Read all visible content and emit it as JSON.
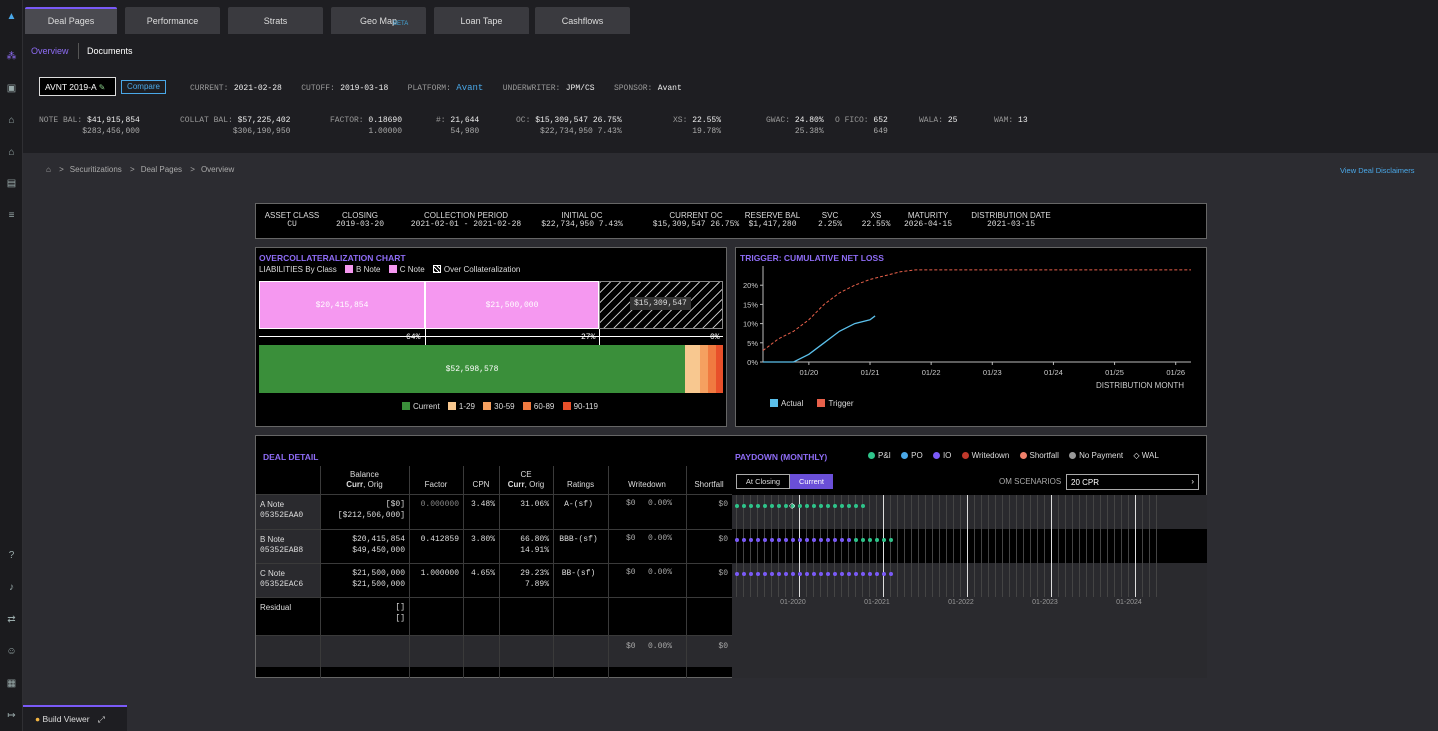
{
  "tabs": [
    "Deal Pages",
    "Performance",
    "Strats",
    "Geo Map",
    "Loan Tape",
    "Cashflows"
  ],
  "beta": "BETA",
  "subtabs": [
    "Overview",
    "Documents"
  ],
  "deal": {
    "name": "AVNT 2019-A",
    "compare": "Compare",
    "current_label": "CURRENT:",
    "current": "2021-02-28",
    "cutoff_label": "CUTOFF:",
    "cutoff": "2019-03-18",
    "platform_label": "PLATFORM:",
    "platform": "Avant",
    "underwriter_label": "UNDERWRITER:",
    "underwriter": "JPM/CS",
    "sponsor_label": "SPONSOR:",
    "sponsor": "Avant"
  },
  "metrics": [
    {
      "label": "NOTE BAL:",
      "v1": "$41,915,854",
      "v2": "$283,456,000"
    },
    {
      "label": "COLLAT BAL:",
      "v1": "$57,225,402",
      "v2": "$306,190,950"
    },
    {
      "label": "FACTOR:",
      "v1": "0.18690",
      "v2": "1.00000"
    },
    {
      "label": "#:",
      "v1": "21,644",
      "v2": "54,980"
    },
    {
      "label": "OC:",
      "v1": "$15,309,547 26.75%",
      "v2": "$22,734,950  7.43%"
    },
    {
      "label": "XS:",
      "v1": "22.55%",
      "v2": "19.78%"
    },
    {
      "label": "GWAC:",
      "v1": "24.80%",
      "v2": "25.38%"
    },
    {
      "label": "O FICO:",
      "v1": "652",
      "v2": "649"
    },
    {
      "label": "WALA:",
      "v1": "25",
      "v2": ""
    },
    {
      "label": "WAM:",
      "v1": "13",
      "v2": ""
    }
  ],
  "breadcrumb": [
    "Securitizations",
    "Deal Pages",
    "Overview"
  ],
  "disclaimers": "View Deal Disclaimers",
  "summary": [
    {
      "h": "ASSET CLASS",
      "v": "CU"
    },
    {
      "h": "CLOSING",
      "v": "2019-03-20"
    },
    {
      "h": "COLLECTION PERIOD",
      "v": "2021-02-01 - 2021-02-28"
    },
    {
      "h": "INITIAL OC",
      "v": "$22,734,950  7.43%"
    },
    {
      "h": "CURRENT OC",
      "v": "$15,309,547  26.75%"
    },
    {
      "h": "RESERVE BAL",
      "v": "$1,417,280"
    },
    {
      "h": "SVC",
      "v": "2.25%"
    },
    {
      "h": "XS",
      "v": "22.55%"
    },
    {
      "h": "MATURITY",
      "v": "2026-04-15"
    },
    {
      "h": "DISTRIBUTION DATE",
      "v": "2021-03-15"
    }
  ],
  "oc_chart": {
    "title": "OVERCOLLATERALIZATION CHART",
    "liab_label": "LIABILITIES By Class",
    "legend": [
      "B Note",
      "C Note",
      "Over Collateralization"
    ],
    "bars": [
      "$20,415,854",
      "$21,500,000",
      "$15,309,547"
    ],
    "pcts": [
      "64%",
      "27%",
      "0%"
    ],
    "collat": "$52,598,578",
    "collat_legend": [
      "Current",
      "1-29",
      "30-59",
      "60-89",
      "90-119"
    ],
    "colors": {
      "b": "#f598f0",
      "c": "#f598f0",
      "current": "#3a8f3a",
      "d1": "#f8c890",
      "d2": "#f5a060",
      "d3": "#f07a40",
      "d4": "#e8502a"
    }
  },
  "trigger_chart": {
    "title": "TRIGGER: CUMULATIVE NET LOSS",
    "yticks": [
      "20%",
      "15%",
      "10%",
      "5%",
      "0%"
    ],
    "xticks": [
      "01/20",
      "01/21",
      "01/22",
      "01/23",
      "01/24",
      "01/25",
      "01/26"
    ],
    "xlabel": "DISTRIBUTION MONTH",
    "legend": [
      "Actual",
      "Trigger"
    ]
  },
  "chart_data": {
    "type": "line",
    "title": "TRIGGER: CUMULATIVE NET LOSS",
    "xlabel": "DISTRIBUTION MONTH",
    "ylabel": "",
    "ylim": [
      0,
      25
    ],
    "series": [
      {
        "name": "Actual",
        "x": [
          "2019-04",
          "2019-07",
          "2019-10",
          "2020-01",
          "2020-04",
          "2020-07",
          "2020-10",
          "2021-01",
          "2021-02"
        ],
        "values": [
          0,
          0,
          0,
          2,
          5,
          8,
          10,
          11,
          12
        ]
      },
      {
        "name": "Trigger",
        "x": [
          "2019-04",
          "2019-07",
          "2019-10",
          "2020-01",
          "2020-04",
          "2020-07",
          "2020-10",
          "2021-01",
          "2021-04",
          "2021-07",
          "2021-10",
          "2022-04",
          "2023-01",
          "2024-01",
          "2025-01",
          "2026-01",
          "2026-04"
        ],
        "values": [
          3,
          6,
          8,
          11,
          15,
          18,
          20,
          21.5,
          22.5,
          23.5,
          24,
          24,
          24,
          24,
          24,
          24,
          24
        ]
      }
    ]
  },
  "deal_detail": {
    "title": "DEAL DETAIL",
    "headers": {
      "balance": "Balance",
      "curr_orig": "Curr",
      "orig": ", Orig",
      "factor": "Factor",
      "cpn": "CPN",
      "ce": "CE",
      "ratings": "Ratings",
      "writedown": "Writedown",
      "shortfall": "Shortfall"
    },
    "rows": [
      {
        "name": "A Note",
        "cusip": "05352EAA0",
        "bal1": "[$0]",
        "bal2": "[$212,506,000]",
        "factor": "0.000000",
        "cpn": "3.48%",
        "ce1": "31.06%",
        "ce2": "",
        "rating": "A-(sf)",
        "wd1": "$0",
        "wd2": "0.00%",
        "sf": "$0"
      },
      {
        "name": "B Note",
        "cusip": "05352EAB8",
        "bal1": "$20,415,854",
        "bal2": "$49,450,000",
        "factor": "0.412859",
        "cpn": "3.80%",
        "ce1": "66.80%",
        "ce2": "14.91%",
        "rating": "BBB-(sf)",
        "wd1": "$0",
        "wd2": "0.00%",
        "sf": "$0"
      },
      {
        "name": "C Note",
        "cusip": "05352EAC6",
        "bal1": "$21,500,000",
        "bal2": "$21,500,000",
        "factor": "1.000000",
        "cpn": "4.65%",
        "ce1": "29.23%",
        "ce2": "7.89%",
        "rating": "BB-(sf)",
        "wd1": "$0",
        "wd2": "0.00%",
        "sf": "$0"
      },
      {
        "name": "Residual",
        "cusip": "",
        "bal1": "[]",
        "bal2": "[]",
        "factor": "",
        "cpn": "",
        "ce1": "",
        "ce2": "",
        "rating": "",
        "wd1": "",
        "wd2": "",
        "sf": ""
      }
    ],
    "total": {
      "wd1": "$0",
      "wd2": "0.00%",
      "sf": "$0"
    }
  },
  "paydown": {
    "title": "PAYDOWN (MONTHLY)",
    "legend": [
      "P&I",
      "PO",
      "IO",
      "Writedown",
      "Shortfall",
      "No Payment",
      "WAL"
    ],
    "toggle": [
      "At Closing",
      "Current"
    ],
    "om_label": "OM SCENARIOS",
    "om_value": "20 CPR",
    "xticks": [
      "01-2020",
      "01-2021",
      "01-2022",
      "01-2023",
      "01-2024"
    ]
  },
  "footer": {
    "build": "Build Viewer"
  }
}
